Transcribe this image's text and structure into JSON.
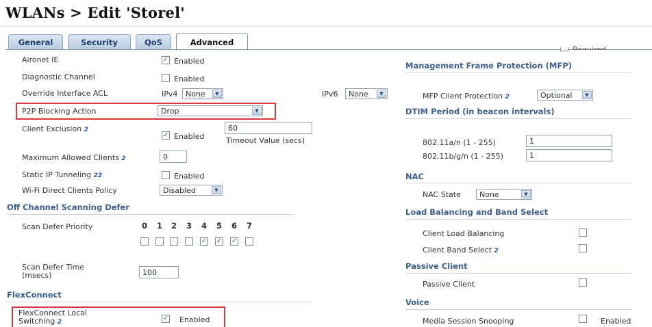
{
  "page": {
    "title": "WLANs > Edit  'Storel'"
  },
  "tabs": [
    {
      "label": "General",
      "active": false
    },
    {
      "label": "Security",
      "active": false
    },
    {
      "label": "QoS",
      "active": false
    },
    {
      "label": "Advanced",
      "active": true
    }
  ],
  "partial_text": {
    "right_top": "Required"
  },
  "left": {
    "aironet": {
      "label": "Aironet IE",
      "checked": true,
      "enabled_text": "Enabled"
    },
    "diagnostic": {
      "label": "Diagnostic Channel",
      "checked": false,
      "enabled_text": "Enabled"
    },
    "override_acl": {
      "label": "Override Interface ACL",
      "ipv4_label": "IPv4",
      "ipv4_value": "None",
      "ipv6_label": "IPv6",
      "ipv6_value": "None"
    },
    "p2p": {
      "label": "P2P Blocking Action",
      "value": "Drop"
    },
    "client_exclusion": {
      "label": "Client Exclusion",
      "checked": true,
      "enabled_text": "Enabled",
      "timeout_value": "60",
      "timeout_label": "Timeout Value (secs)"
    },
    "max_clients": {
      "label": "Maximum Allowed Clients",
      "value": "0"
    },
    "static_ip": {
      "label": "Static IP Tunneling",
      "checked": false,
      "enabled_text": "Enabled"
    },
    "wifi_direct": {
      "label": "Wi-Fi Direct Clients Policy",
      "value": "Disabled"
    },
    "off_channel": {
      "heading": "Off Channel Scanning Defer",
      "priority_label": "Scan Defer Priority",
      "priorities": [
        {
          "digit": "0",
          "checked": false
        },
        {
          "digit": "1",
          "checked": false
        },
        {
          "digit": "2",
          "checked": false
        },
        {
          "digit": "3",
          "checked": false
        },
        {
          "digit": "4",
          "checked": true
        },
        {
          "digit": "5",
          "checked": true
        },
        {
          "digit": "6",
          "checked": true
        },
        {
          "digit": "7",
          "checked": false
        }
      ],
      "time_label_1": "Scan Defer Time",
      "time_label_2": "(msecs)",
      "time_value": "100"
    },
    "flexconnect": {
      "heading": "FlexConnect",
      "local_switching_1": "FlexConnect Local",
      "local_switching_2": "Switching",
      "checked": true,
      "enabled_text": "Enabled"
    }
  },
  "right": {
    "mfp": {
      "heading": "Management Frame Protection (MFP)",
      "label": "MFP Client Protection",
      "value": "Optional"
    },
    "dtim": {
      "heading": "DTIM Period (in beacon intervals)",
      "a_label": "802.11a/n (1 - 255)",
      "a_value": "1",
      "b_label": "802.11b/g/n (1 - 255)",
      "b_value": "1"
    },
    "nac": {
      "heading": "NAC",
      "label": "NAC State",
      "value": "None"
    },
    "lb": {
      "heading": "Load Balancing and Band Select",
      "load_label": "Client Load Balancing",
      "band_label": "Client Band Select"
    },
    "passive": {
      "heading": "Passive Client",
      "label": "Passive Client"
    },
    "voice": {
      "heading": "Voice",
      "label": "Media Session Snooping",
      "enabled_text": "Enabled"
    }
  }
}
